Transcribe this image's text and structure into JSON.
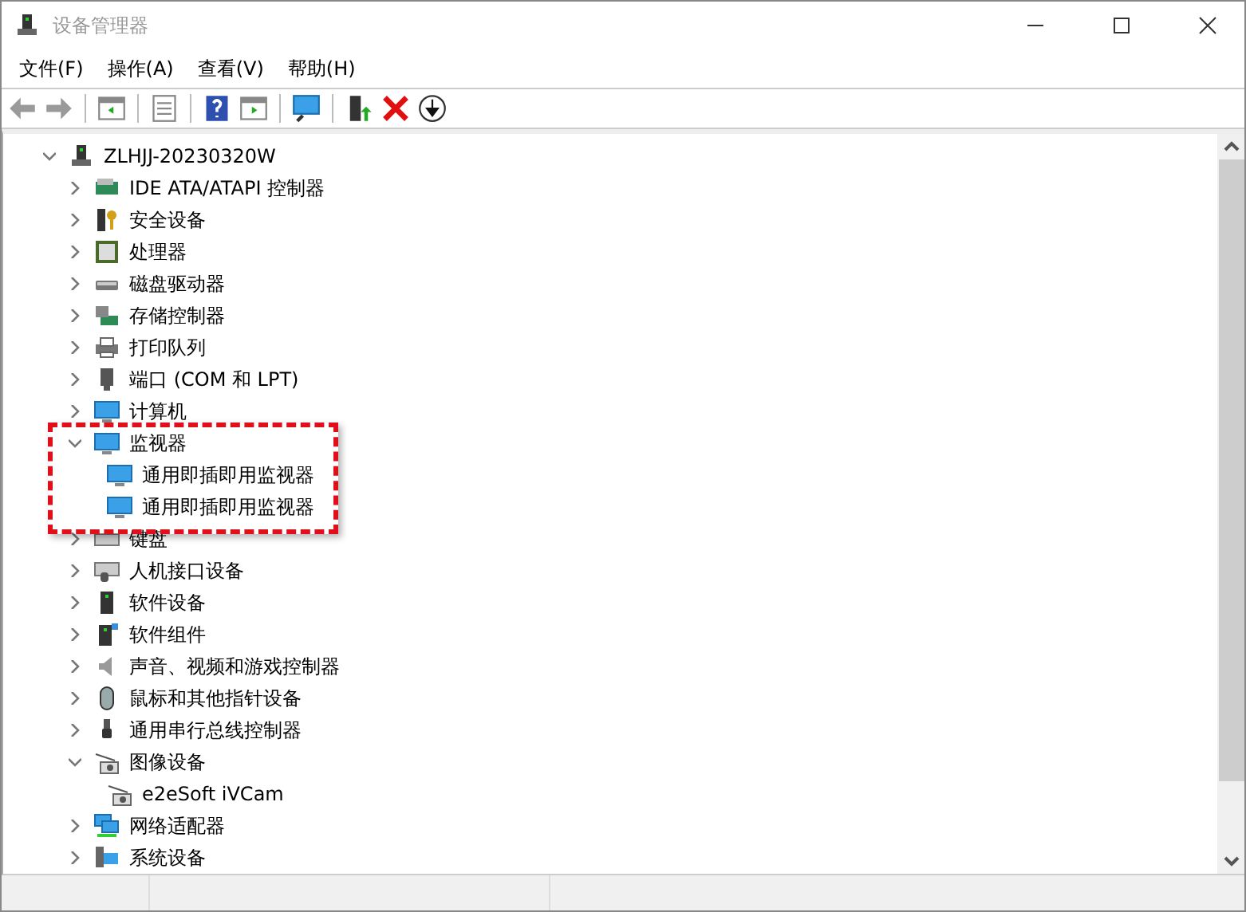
{
  "window": {
    "title": "设备管理器"
  },
  "menu": [
    "文件(F)",
    "操作(A)",
    "查看(V)",
    "帮助(H)"
  ],
  "tree": {
    "label": "ZLHJJ-20230320W",
    "expanded": true,
    "children": [
      {
        "label": "IDE ATA/ATAPI 控制器",
        "expanded": false
      },
      {
        "label": "安全设备",
        "expanded": false
      },
      {
        "label": "处理器",
        "expanded": false
      },
      {
        "label": "磁盘驱动器",
        "expanded": false
      },
      {
        "label": "存储控制器",
        "expanded": false
      },
      {
        "label": "打印队列",
        "expanded": false
      },
      {
        "label": "端口 (COM 和 LPT)",
        "expanded": false
      },
      {
        "label": "计算机",
        "expanded": false
      },
      {
        "label": "监视器",
        "expanded": true,
        "highlighted": true,
        "children": [
          {
            "label": "通用即插即用监视器"
          },
          {
            "label": "通用即插即用监视器"
          }
        ]
      },
      {
        "label": "键盘",
        "expanded": false
      },
      {
        "label": "人机接口设备",
        "expanded": false
      },
      {
        "label": "软件设备",
        "expanded": false
      },
      {
        "label": "软件组件",
        "expanded": false
      },
      {
        "label": "声音、视频和游戏控制器",
        "expanded": false
      },
      {
        "label": "鼠标和其他指针设备",
        "expanded": false
      },
      {
        "label": "通用串行总线控制器",
        "expanded": false
      },
      {
        "label": "图像设备",
        "expanded": true,
        "children": [
          {
            "label": "e2eSoft iVCam"
          }
        ]
      },
      {
        "label": "网络适配器",
        "expanded": false
      },
      {
        "label": "系统设备",
        "expanded": false
      }
    ]
  }
}
